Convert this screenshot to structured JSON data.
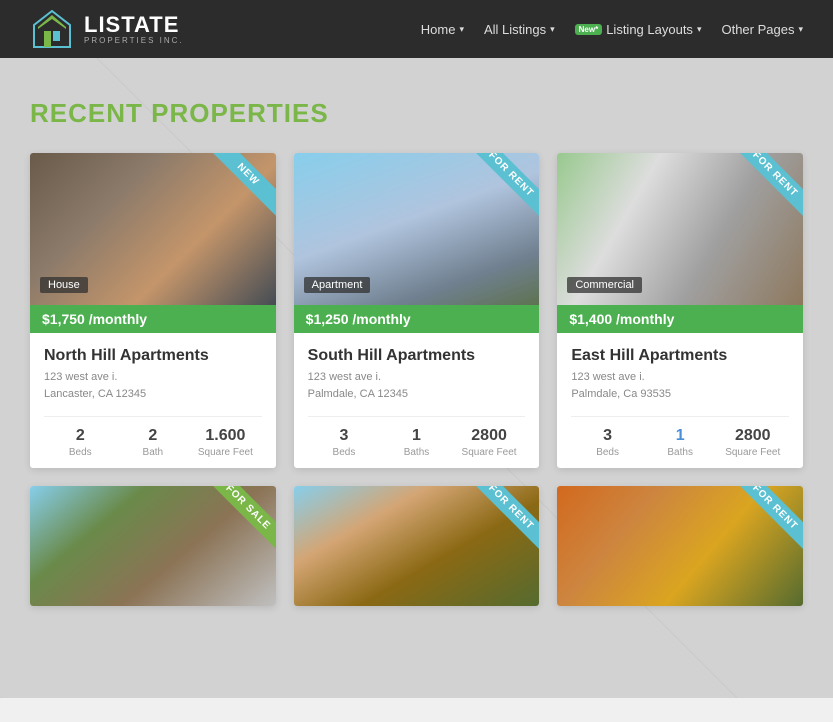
{
  "navbar": {
    "logo_title": "LISTATE",
    "logo_sub": "PROPERTIES INC.",
    "nav_items": [
      {
        "label": "Home",
        "has_chevron": true
      },
      {
        "label": "All Listings",
        "has_chevron": true
      },
      {
        "label": "Listing Layouts",
        "has_chevron": true,
        "badge": "New*"
      },
      {
        "label": "Other Pages",
        "has_chevron": true
      }
    ]
  },
  "section": {
    "title": "RECENT PROPERTIES"
  },
  "properties": [
    {
      "id": 1,
      "ribbon": "NEW",
      "ribbon_class": "new",
      "type": "House",
      "price": "$1,750 /monthly",
      "title": "North Hill Apartments",
      "address_line1": "123 west ave i.",
      "address_line2": "Lancaster, CA 12345",
      "beds_value": "2",
      "beds_label": "Beds",
      "baths_value": "2",
      "baths_label": "Bath",
      "area_value": "1.600",
      "area_label": "Square Feet",
      "baths_blue": false,
      "img_class": "img-house1"
    },
    {
      "id": 2,
      "ribbon": "FOR RENT",
      "ribbon_class": "for-rent",
      "type": "Apartment",
      "price": "$1,250 /monthly",
      "title": "South Hill Apartments",
      "address_line1": "123 west ave i.",
      "address_line2": "Palmdale, CA 12345",
      "beds_value": "3",
      "beds_label": "Beds",
      "baths_value": "1",
      "baths_label": "Baths",
      "area_value": "2800",
      "area_label": "Square Feet",
      "baths_blue": false,
      "img_class": "img-apt1"
    },
    {
      "id": 3,
      "ribbon": "FOR RENT",
      "ribbon_class": "for-rent",
      "type": "Commercial",
      "price": "$1,400 /monthly",
      "title": "East Hill Apartments",
      "address_line1": "123 west ave i.",
      "address_line2": "Palmdale, Ca 93535",
      "beds_value": "3",
      "beds_label": "Beds",
      "baths_value": "1",
      "baths_label": "Baths",
      "area_value": "2800",
      "area_label": "Square Feet",
      "baths_blue": true,
      "img_class": "img-commercial1"
    }
  ],
  "bottom_ribbons": [
    "FOR SALE",
    "FOR RENT",
    "FOR RENT"
  ],
  "bottom_img_classes": [
    "img-house2",
    "img-apt2",
    "img-house3"
  ]
}
